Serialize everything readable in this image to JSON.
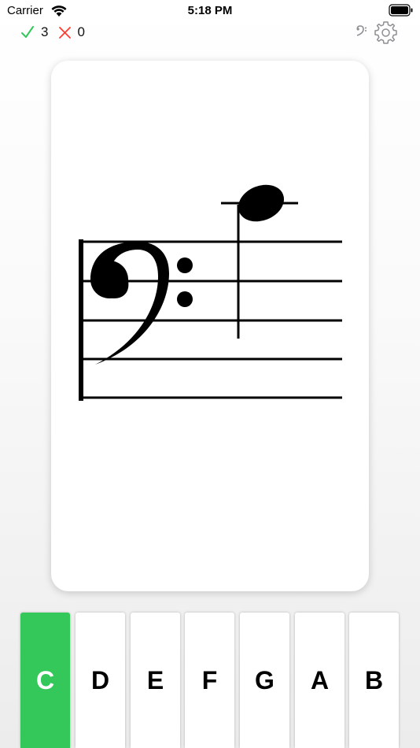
{
  "status_bar": {
    "carrier": "Carrier",
    "time": "5:18 PM"
  },
  "score": {
    "correct": "3",
    "incorrect": "0"
  },
  "icons": {
    "correct": "checkmark-icon",
    "incorrect": "x-icon",
    "clef": "bass-clef-icon",
    "settings": "gear-icon"
  },
  "colors": {
    "accent_green": "#34c759",
    "incorrect_red": "#ff3b30",
    "icon_gray": "#8e8e93"
  },
  "staff": {
    "clef": "bass",
    "note": "C",
    "ledger_lines_above": 1
  },
  "keys": [
    {
      "label": "C",
      "active": true
    },
    {
      "label": "D",
      "active": false
    },
    {
      "label": "E",
      "active": false
    },
    {
      "label": "F",
      "active": false
    },
    {
      "label": "G",
      "active": false
    },
    {
      "label": "A",
      "active": false
    },
    {
      "label": "B",
      "active": false
    }
  ]
}
